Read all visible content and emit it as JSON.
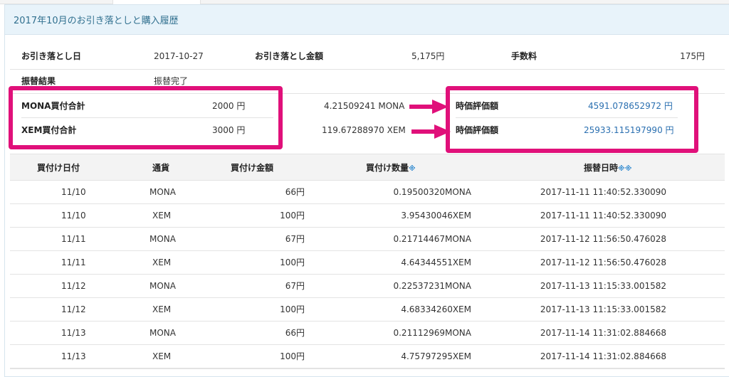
{
  "panel": {
    "title": "2017年10月のお引き落としと購入履歴"
  },
  "summary": {
    "debit_date_label": "お引き落とし日",
    "debit_date": "2017-10-27",
    "debit_amount_label": "お引き落とし金額",
    "debit_amount": "5,175円",
    "fee_label": "手数料",
    "fee": "175円",
    "transfer_result_label": "振替結果",
    "transfer_result": "振替完了"
  },
  "holdings": [
    {
      "label": "MONA買付合計",
      "total": "2000 円",
      "quantity": "4.21509241 MONA",
      "valuation_label": "時価評価額",
      "valuation": "4591.078652972 円"
    },
    {
      "label": "XEM買付合計",
      "total": "3000 円",
      "quantity": "119.67288970 XEM",
      "valuation_label": "時価評価額",
      "valuation": "25933.115197990 円"
    }
  ],
  "table": {
    "headers": {
      "date": "買付け日付",
      "currency": "通貨",
      "amount": "買付け金額",
      "quantity": "買付け数量",
      "quantity_mark": "※",
      "transfer": "振替日時",
      "transfer_mark": "※※"
    },
    "rows": [
      {
        "date": "11/10",
        "currency": "MONA",
        "amount": "66円",
        "quantity": "0.19500320MONA",
        "transfer": "2017-11-11 11:40:52.330090"
      },
      {
        "date": "11/10",
        "currency": "XEM",
        "amount": "100円",
        "quantity": "3.95430046XEM",
        "transfer": "2017-11-11 11:40:52.330090"
      },
      {
        "date": "11/11",
        "currency": "MONA",
        "amount": "67円",
        "quantity": "0.21714467MONA",
        "transfer": "2017-11-12 11:56:50.476028"
      },
      {
        "date": "11/11",
        "currency": "XEM",
        "amount": "100円",
        "quantity": "4.64344551XEM",
        "transfer": "2017-11-12 11:56:50.476028"
      },
      {
        "date": "11/12",
        "currency": "MONA",
        "amount": "67円",
        "quantity": "0.22537231MONA",
        "transfer": "2017-11-13 11:15:33.001582"
      },
      {
        "date": "11/12",
        "currency": "XEM",
        "amount": "100円",
        "quantity": "4.68334260XEM",
        "transfer": "2017-11-13 11:15:33.001582"
      },
      {
        "date": "11/13",
        "currency": "MONA",
        "amount": "66円",
        "quantity": "0.21112969MONA",
        "transfer": "2017-11-14 11:31:02.884668"
      },
      {
        "date": "11/13",
        "currency": "XEM",
        "amount": "100円",
        "quantity": "4.75797295XEM",
        "transfer": "2017-11-14 11:31:02.884668"
      }
    ]
  },
  "colors": {
    "highlight": "#e0107a",
    "link": "#2a6fb0",
    "header_bg": "#e8f3fa"
  }
}
